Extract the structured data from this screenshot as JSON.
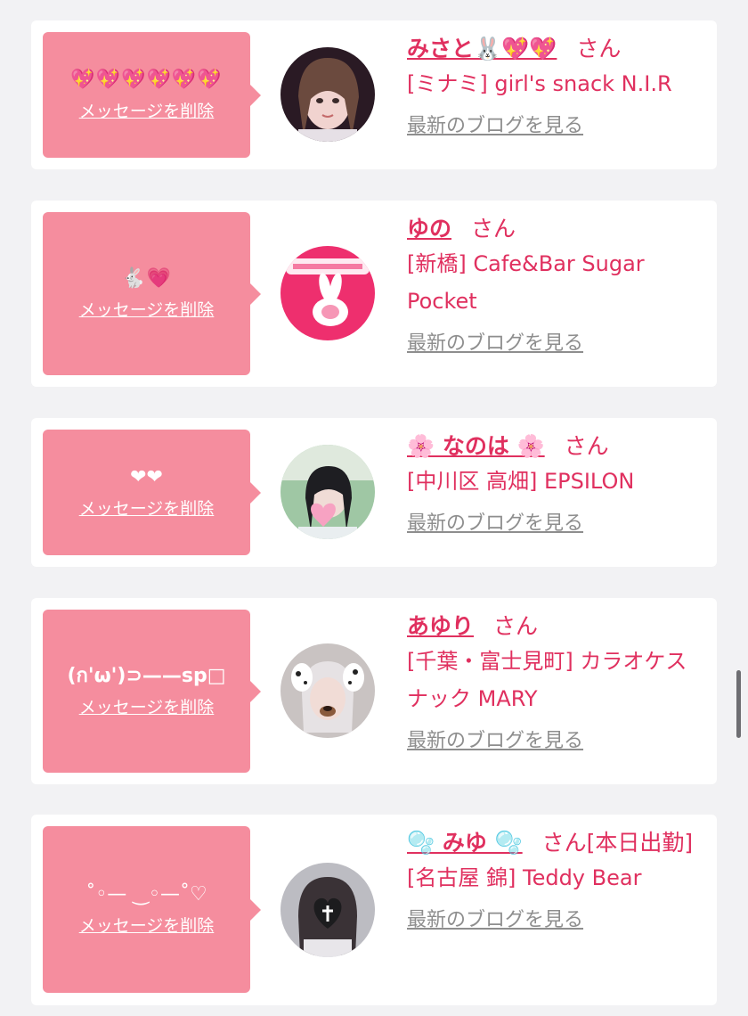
{
  "delete_label": "メッセージを削除",
  "blog_label": "最新のブログを見る",
  "san": "さん",
  "colors": {
    "accent": "#e0305f",
    "bubble": "#f58d9e",
    "link_gray": "#8e8e8e"
  },
  "entries": [
    {
      "message": "💖💖💖💖💖💖",
      "name": "みさと🐰💖💖",
      "san": "さん",
      "shop": "[ミナミ] girl's snack N.I.R",
      "avatar_icon": "avatar-photo-girl"
    },
    {
      "message": "🐇💗",
      "name": "ゆの",
      "san": "さん",
      "shop": "[新橋] Cafe&Bar Sugar Pocket",
      "avatar_icon": "avatar-pink-rabbit"
    },
    {
      "message": "❤❤",
      "name": "🌸 なのは 🌸",
      "san": "さん",
      "shop": "[中川区 高畑] EPSILON",
      "avatar_icon": "avatar-photo-girl-heart"
    },
    {
      "message": "(ก'ω')⊃——sp□",
      "name": "あゆり",
      "san": "さん",
      "shop": "[千葉・富士見町] カラオケスナック MARY",
      "avatar_icon": "avatar-photo-dog-filter"
    },
    {
      "message": "˚◦— ‿◦—˚♡",
      "name": "🫧 みゆ 🫧",
      "san": "さん[本日出勤]",
      "shop": "[名古屋 錦] Teddy Bear",
      "avatar_icon": "avatar-photo-heart-mask"
    }
  ]
}
